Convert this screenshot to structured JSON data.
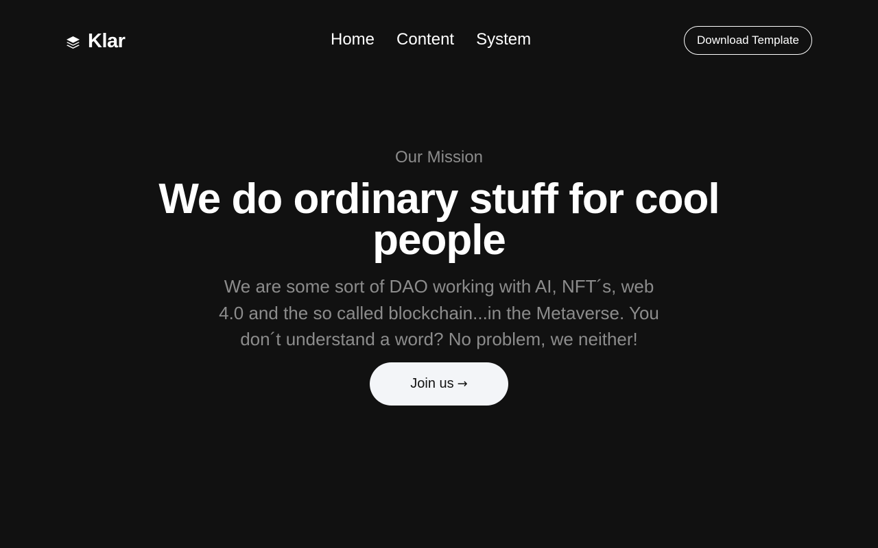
{
  "header": {
    "brand_name": "Klar",
    "brand_icon": "layers-icon",
    "nav": [
      {
        "label": "Home"
      },
      {
        "label": "Content"
      },
      {
        "label": "System"
      }
    ],
    "download_label": "Download Template"
  },
  "hero": {
    "eyebrow": "Our Mission",
    "headline": "We do ordinary stuff for cool people",
    "subtext": "We are some sort of DAO working with AI, NFT´s, web 4.0 and the so called blockchain...in the Metaverse. You don´t understand a word? No problem, we neither!",
    "cta_label": "Join us",
    "cta_icon": "arrow-right-icon",
    "cta_arrow": "→"
  },
  "colors": {
    "background": "#111111",
    "text": "#ffffff",
    "muted": "#8c8c8c",
    "button_bg": "#f3f5f8"
  }
}
